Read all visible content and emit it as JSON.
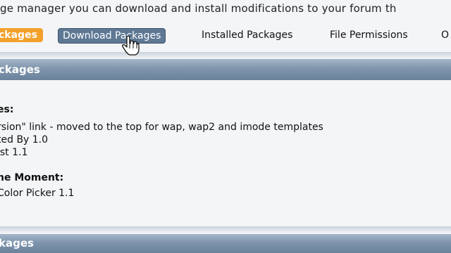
{
  "intro_text": "ge manager you can download and install modifications to your forum th",
  "tabs": [
    {
      "label": "ckages"
    },
    {
      "label": "Download Packages"
    },
    {
      "label": "Installed Packages"
    },
    {
      "label": "File Permissions"
    },
    {
      "label": "O"
    }
  ],
  "section1": {
    "title": "ckages",
    "heading_updates": "es:",
    "update_lines": [
      "rsion\" link - moved to the top for wap, wap2 and imode templates",
      "ted By 1.0",
      "ist 1.1"
    ],
    "heading_moment": "he Moment:",
    "moment_lines": [
      "Color Picker 1.1"
    ]
  },
  "section2": {
    "title": "kages"
  },
  "colors": {
    "active_tab": "#f2a12c",
    "hover_tab": "#5e7894",
    "section_bar": "#7f95ad"
  },
  "icons": {
    "cursor": "hand-pointer-icon"
  }
}
